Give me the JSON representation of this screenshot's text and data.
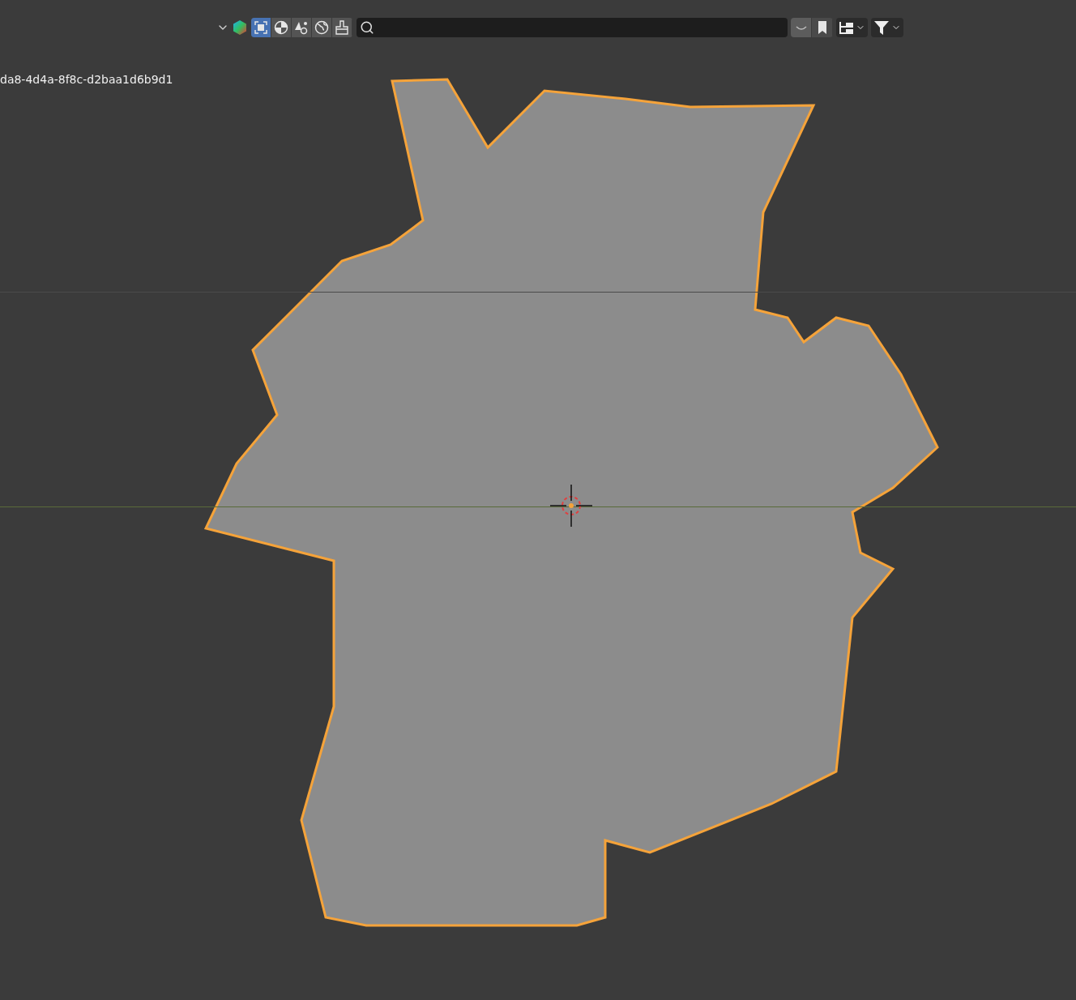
{
  "header": {
    "mode_buttons": [
      {
        "kind": "square",
        "selected": true
      },
      {
        "kind": "sphere",
        "selected": false
      },
      {
        "kind": "shapes",
        "selected": false
      },
      {
        "kind": "world",
        "selected": false
      },
      {
        "kind": "brush",
        "selected": false
      }
    ],
    "toggles": [
      {
        "kind": "curve",
        "selected": true
      },
      {
        "kind": "bookmark",
        "selected": false
      }
    ]
  },
  "object_label": "da8-4d4a-8f8c-d2baa1d6b9d1"
}
